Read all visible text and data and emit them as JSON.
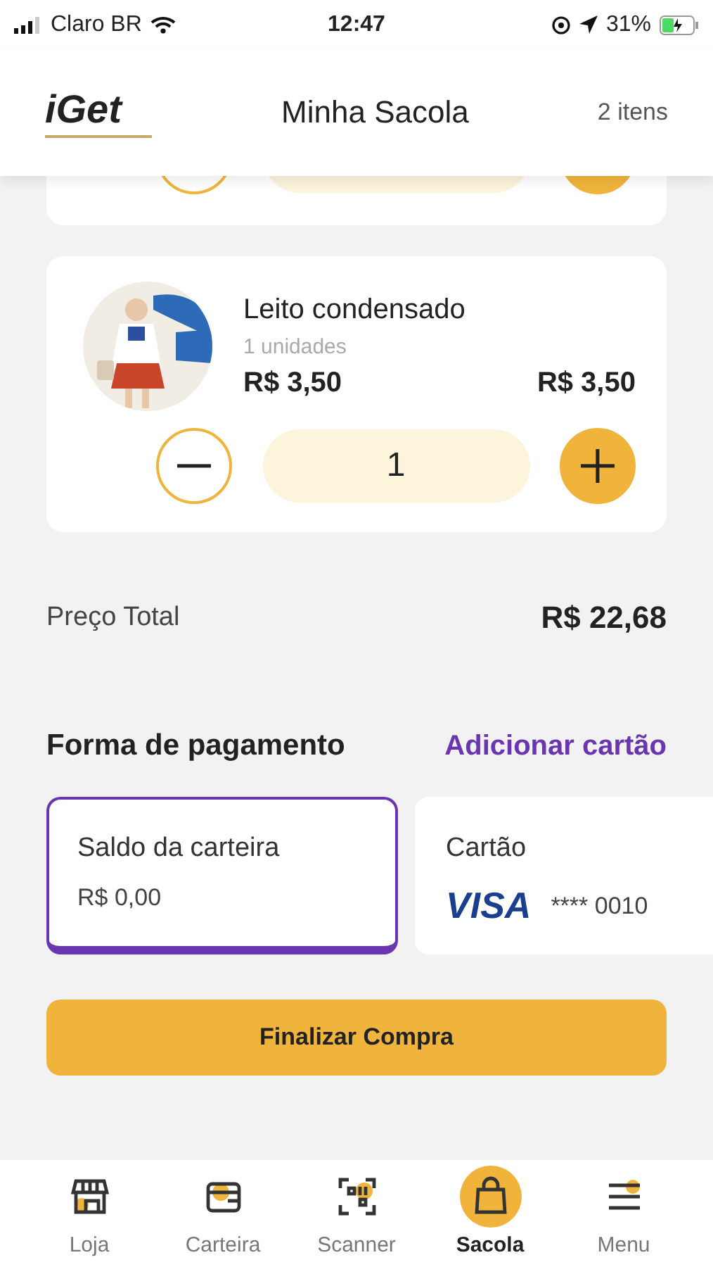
{
  "status_bar": {
    "carrier": "Claro BR",
    "time": "12:47",
    "battery": "31%"
  },
  "header": {
    "logo": "iGet",
    "title": "Minha Sacola",
    "count": "2 itens"
  },
  "cart_items": [
    {
      "kind": "partial"
    },
    {
      "kind": "full",
      "name": "Leito condensado",
      "units": "1 unidades",
      "unit_price": "R$ 3,50",
      "total_price": "R$ 3,50",
      "quantity": "1"
    }
  ],
  "total": {
    "label": "Preço Total",
    "value": "R$ 22,68"
  },
  "payment": {
    "title": "Forma de pagamento",
    "add_link": "Adicionar cartão",
    "methods": [
      {
        "kind": "wallet",
        "title": "Saldo da carteira",
        "detail": "R$ 0,00",
        "selected": true
      },
      {
        "kind": "card",
        "title": "Cartão",
        "brand": "VISA",
        "detail": "**** 0010",
        "selected": false
      }
    ]
  },
  "checkout_button": "Finalizar Compra",
  "nav": [
    {
      "kind": "store",
      "label": "Loja",
      "selected": false
    },
    {
      "kind": "wallet",
      "label": "Carteira",
      "selected": false
    },
    {
      "kind": "scanner",
      "label": "Scanner",
      "selected": false
    },
    {
      "kind": "bag",
      "label": "Sacola",
      "selected": true
    },
    {
      "kind": "menu",
      "label": "Menu",
      "selected": false
    }
  ]
}
